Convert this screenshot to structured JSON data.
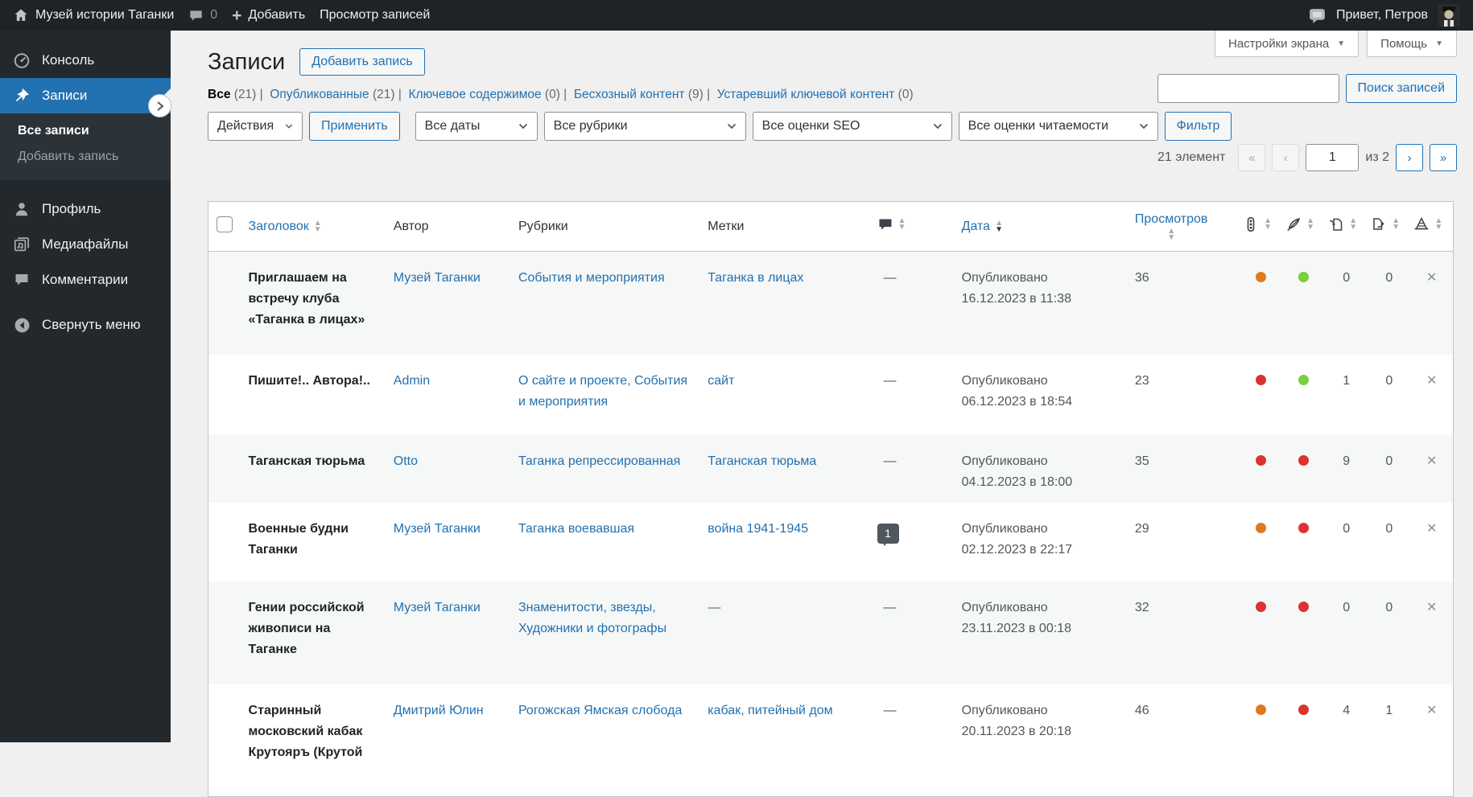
{
  "admin_bar": {
    "site_name": "Музей истории Таганки",
    "comments_count": "0",
    "add_new_label": "Добавить",
    "view_posts_label": "Просмотр записей",
    "greeting": "Привет, Петров"
  },
  "sidebar": {
    "dashboard": "Консоль",
    "posts": "Записи",
    "all_posts": "Все записи",
    "add_post": "Добавить запись",
    "profile": "Профиль",
    "media": "Медиафайлы",
    "comments": "Комментарии",
    "collapse": "Свернуть меню"
  },
  "screen_tabs": {
    "screen_options": "Настройки экрана",
    "help": "Помощь"
  },
  "page": {
    "title": "Записи",
    "add_new_button": "Добавить запись"
  },
  "views": [
    {
      "label": "Все",
      "count": "(21)",
      "current": true
    },
    {
      "label": "Опубликованные",
      "count": "(21)",
      "current": false
    },
    {
      "label": "Ключевое содержимое",
      "count": "(0)",
      "current": false
    },
    {
      "label": "Бесхозный контент",
      "count": "(9)",
      "current": false
    },
    {
      "label": "Устаревший ключевой контент",
      "count": "(0)",
      "current": false
    }
  ],
  "search": {
    "value": "",
    "button_label": "Поиск записей"
  },
  "filters": {
    "bulk_action": "Действия",
    "apply_button": "Применить",
    "date_filter": "Все даты",
    "category_filter": "Все рубрики",
    "seo_filter": "Все оценки SEO",
    "readability_filter": "Все оценки читаемости",
    "filter_button": "Фильтр"
  },
  "pagination": {
    "total": "21 элемент",
    "first": "«",
    "prev": "‹",
    "page": "1",
    "of": "из 2",
    "next": "›",
    "last": "»"
  },
  "table": {
    "columns": {
      "title": "Заголовок",
      "author": "Автор",
      "categories": "Рубрики",
      "tags": "Метки",
      "date": "Дата",
      "views": "Просмотров"
    },
    "icon_columns": {
      "comments": "comment-bubble",
      "seo": "traffic-light",
      "readability": "feather",
      "links_incoming": "document-arrow-in",
      "links_outgoing": "document-arrow-out",
      "cornerstone": "warning-cone"
    },
    "rows": [
      {
        "title": "Приглашаем на встречу клуба «Таганка в лицах»",
        "author": "Музей Таганки",
        "categories": "События и мероприятия",
        "tags": "Таганка в лицах",
        "comments": "—",
        "status": "Опубликовано",
        "date": "16.12.2023 в 11:38",
        "views": "36",
        "seo": "orange",
        "readability": "green",
        "links_in": "0",
        "links_out": "0",
        "cornerstone": "✕"
      },
      {
        "title": "Пишите!.. Автора!..",
        "author": "Admin",
        "categories": "О сайте и проекте, События и мероприятия",
        "tags": "сайт",
        "comments": "—",
        "status": "Опубликовано",
        "date": "06.12.2023 в 18:54",
        "views": "23",
        "seo": "red",
        "readability": "green",
        "links_in": "1",
        "links_out": "0",
        "cornerstone": "✕"
      },
      {
        "title": "Таганская тюрьма",
        "author": "Otto",
        "categories": "Таганка репрессированная",
        "tags": "Таганская тюрьма",
        "comments": "—",
        "status": "Опубликовано",
        "date": "04.12.2023 в 18:00",
        "views": "35",
        "seo": "red",
        "readability": "red",
        "links_in": "9",
        "links_out": "0",
        "cornerstone": "✕"
      },
      {
        "title": "Военные будни Таганки",
        "author": "Музей Таганки",
        "categories": "Таганка воевавшая",
        "tags": "война 1941-1945",
        "comments": "1",
        "status": "Опубликовано",
        "date": "02.12.2023 в 22:17",
        "views": "29",
        "seo": "orange",
        "readability": "red",
        "links_in": "0",
        "links_out": "0",
        "cornerstone": "✕"
      },
      {
        "title": "Гении российской живописи на Таганке",
        "author": "Музей Таганки",
        "categories": "Знаменитости, звезды, Художники и фотографы",
        "tags": "—",
        "comments": "—",
        "status": "Опубликовано",
        "date": "23.11.2023 в 00:18",
        "views": "32",
        "seo": "red",
        "readability": "red",
        "links_in": "0",
        "links_out": "0",
        "cornerstone": "✕"
      },
      {
        "title": "Старинный московский кабак Крутояръ (Крутой",
        "author": "Дмитрий Юлин",
        "categories": "Рогожская Ямская слобода",
        "tags": "кабак, питейный дом",
        "comments": "—",
        "status": "Опубликовано",
        "date": "20.11.2023 в 20:18",
        "views": "46",
        "seo": "orange",
        "readability": "red",
        "links_in": "4",
        "links_out": "1",
        "cornerstone": "✕"
      }
    ]
  },
  "score_colors": {
    "orange": "#e1781e",
    "green": "#7ad03a",
    "red": "#dc3232"
  }
}
